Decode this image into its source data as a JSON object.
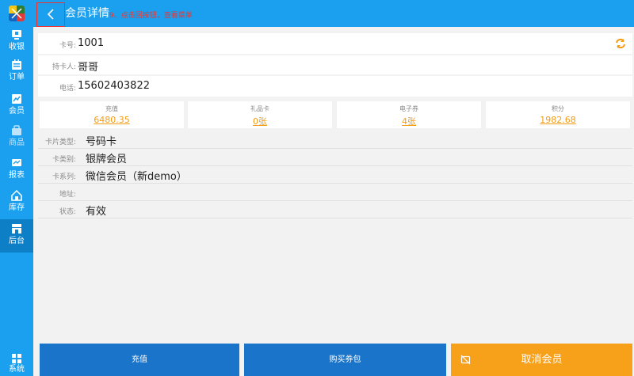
{
  "sidebar": {
    "items": [
      {
        "label": "收银",
        "icon": "cashier-icon"
      },
      {
        "label": "订单",
        "icon": "order-icon"
      },
      {
        "label": "会员",
        "icon": "member-icon"
      },
      {
        "label": "商品",
        "icon": "goods-icon"
      },
      {
        "label": "报表",
        "icon": "report-icon"
      },
      {
        "label": "库存",
        "icon": "inventory-icon"
      },
      {
        "label": "后台",
        "icon": "backend-icon"
      },
      {
        "label": "系统",
        "icon": "system-icon"
      }
    ],
    "active": "后台"
  },
  "header": {
    "title": "会员详情",
    "hint": "9、点击回按钮，查看菜单"
  },
  "member": {
    "card_no_label": "卡号:",
    "card_no": "1001",
    "holder_label": "持卡人:",
    "holder": "哥哥",
    "phone_label": "电话:",
    "phone": "15602403822"
  },
  "stats": [
    {
      "label": "充值",
      "value": "6480.35"
    },
    {
      "label": "礼品卡",
      "value": "0张"
    },
    {
      "label": "电子券",
      "value": "4张"
    },
    {
      "label": "积分",
      "value": "1982.68"
    }
  ],
  "details": [
    {
      "label": "卡片类型:",
      "value": "号码卡"
    },
    {
      "label": "卡类别:",
      "value": "银牌会员"
    },
    {
      "label": "卡系列:",
      "value": "微信会员（新demo）"
    },
    {
      "label": "地址:",
      "value": ""
    },
    {
      "label": "状态:",
      "value": "有效"
    }
  ],
  "actions": {
    "recharge": "充值",
    "buy_coupon": "购买券包",
    "cancel_member": "取消会员"
  },
  "colors": {
    "primary": "#1aa0ef",
    "button_blue": "#1a74c9",
    "accent_orange": "#f7a01a",
    "hint_red": "#e53935"
  }
}
